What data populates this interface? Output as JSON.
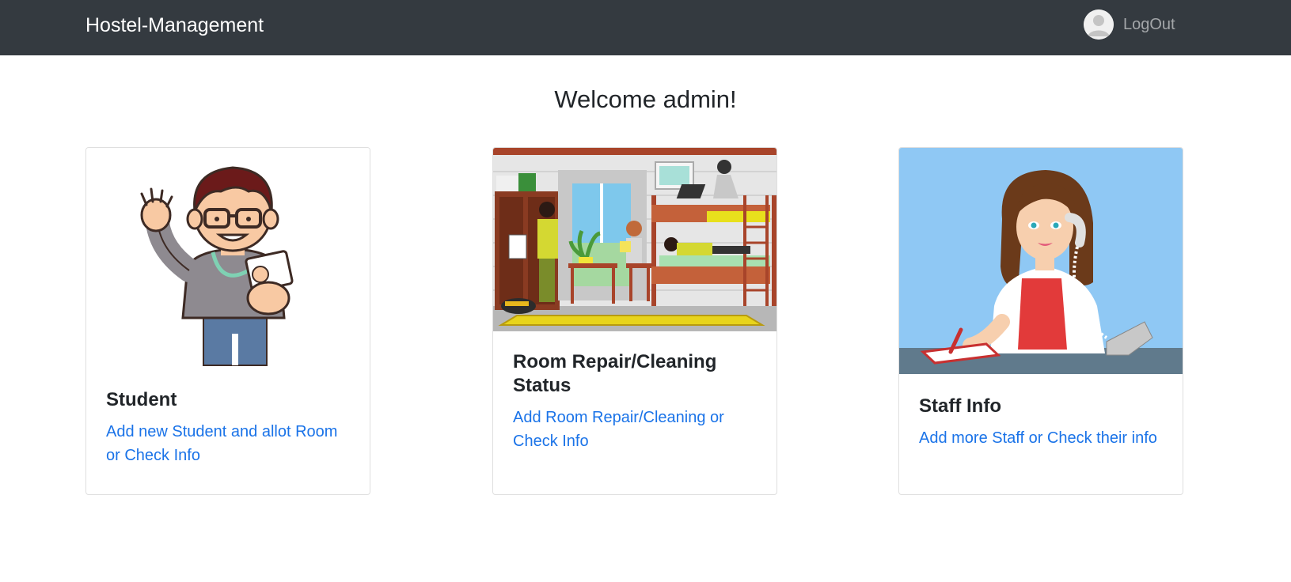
{
  "navbar": {
    "brand": "Hostel-Management",
    "logout_label": "LogOut",
    "avatar_icon": "user-avatar-icon",
    "background": "#343a40"
  },
  "welcome": "Welcome admin!",
  "cards": [
    {
      "title": "Student",
      "link": "Add new Student and allot Room or Check Info",
      "image_icon": "student-illustration"
    },
    {
      "title": "Room Repair/Cleaning Status",
      "link": "Add Room Repair/Cleaning or Check Info",
      "image_icon": "dorm-room-illustration"
    },
    {
      "title": "Staff Info",
      "link": "Add more Staff or Check their info",
      "image_icon": "receptionist-illustration"
    }
  ],
  "colors": {
    "link": "#1a73e8",
    "card_border": "#dfdfdf"
  }
}
